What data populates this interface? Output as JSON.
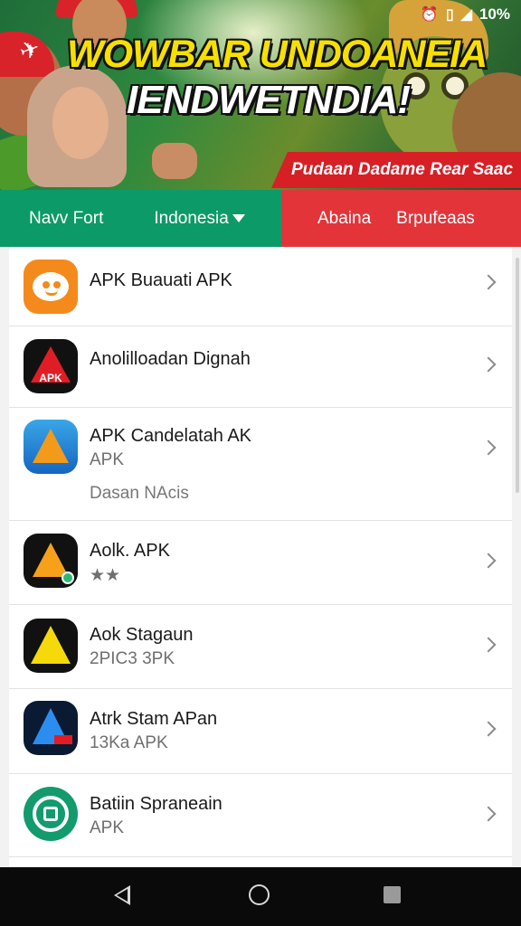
{
  "status": {
    "battery_text": "10%",
    "icons": [
      "alarm-icon",
      "vibrate-icon",
      "signal-icon"
    ]
  },
  "banner": {
    "title_line1": "WOWBAR UNDOANEIA",
    "title_line2": "IENDWETNDIA!",
    "ribbon_text": "Pudaan Dadame Rear Saac"
  },
  "tabs": [
    {
      "label": "Navv Fort"
    },
    {
      "label": "Indonesia",
      "has_dropdown": true
    },
    {
      "label": "Abaina"
    },
    {
      "label": "Brpufeaas"
    }
  ],
  "colors": {
    "tab_green": "#0c9a69",
    "tab_red": "#e3343a",
    "nav_bar": "#0a0a0a"
  },
  "apps": [
    {
      "name": "APK Buauati APK",
      "icon": "orange-face-icon"
    },
    {
      "name": "Anolilloadan Dignah",
      "icon": "apk-red-triangle-icon",
      "icon_text": "APK"
    },
    {
      "name": "APK Candelatah AK",
      "sub": "APK",
      "extra": "Dasan NAcis",
      "icon": "blue-orange-triangle-icon"
    },
    {
      "name": "Aolk. APK",
      "sub": "",
      "icon": "orange-triangle-icon"
    },
    {
      "name": "Aok Stagaun",
      "sub": "2PIC3 3PK",
      "icon": "yellow-triangle-icon"
    },
    {
      "name": "Atrk Stam APan",
      "sub": "13Ka APK",
      "icon": "blue-triangle-icon"
    },
    {
      "name": "Batiin Spraneain",
      "sub": "APK",
      "icon": "green-circle-icon"
    }
  ],
  "navbar": {
    "buttons": [
      "back-icon",
      "home-icon",
      "recents-icon"
    ]
  }
}
